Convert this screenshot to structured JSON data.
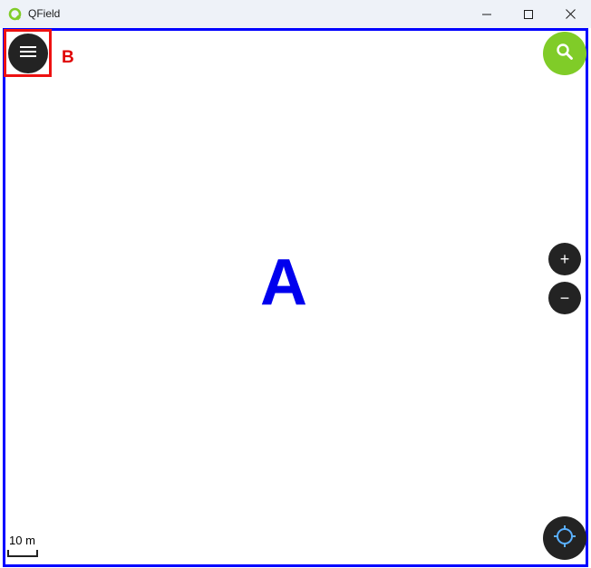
{
  "window": {
    "title": "QField",
    "minimize_icon": "minimize-icon",
    "maximize_icon": "maximize-icon",
    "close_icon": "close-icon"
  },
  "annotations": {
    "label_a": "A",
    "label_b": "B",
    "highlight_color": "#ee1111",
    "map_border_color": "#0000ff"
  },
  "map": {
    "scale_label": "10 m"
  },
  "buttons": {
    "menu_icon": "hamburger-menu-icon",
    "search_icon": "search-icon",
    "zoom_in_label": "+",
    "zoom_out_label": "−",
    "gps_icon": "crosshair-location-icon"
  },
  "colors": {
    "accent": "#80cc28",
    "button_dark": "#232323",
    "titlebar_bg": "#eef2f8"
  }
}
